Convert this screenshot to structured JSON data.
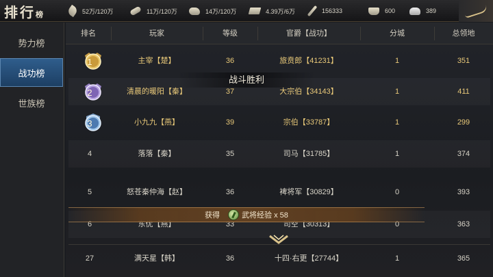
{
  "header": {
    "title": "排行",
    "subtitle": "榜",
    "resources": [
      {
        "icon": "wheat-icon",
        "value": "52万/120万"
      },
      {
        "icon": "wood-icon",
        "value": "11万/120万"
      },
      {
        "icon": "stone-icon",
        "value": "14万/120万"
      },
      {
        "icon": "iron-icon",
        "value": "4.39万/6万"
      },
      {
        "icon": "sword-icon",
        "value": "156333"
      },
      {
        "icon": "gold-ingot-icon",
        "value": "600"
      },
      {
        "icon": "silver-ingot-icon",
        "value": "389"
      }
    ]
  },
  "sidebar": {
    "items": [
      {
        "label": "势力榜"
      },
      {
        "label": "战功榜"
      },
      {
        "label": "世族榜"
      }
    ],
    "active_index": 1
  },
  "table": {
    "columns": [
      "排名",
      "玩家",
      "等级",
      "官爵【战功】",
      "分城",
      "总领地"
    ],
    "rows": [
      {
        "rank": "1",
        "player": "主宰【楚】",
        "level": "36",
        "title": "旅贲郎【41231】",
        "branch": "1",
        "territory": "351"
      },
      {
        "rank": "2",
        "player": "清晨的暖阳【秦】",
        "level": "37",
        "title": "大宗伯【34143】",
        "branch": "1",
        "territory": "411"
      },
      {
        "rank": "3",
        "player": "小九九【燕】",
        "level": "39",
        "title": "宗伯【33787】",
        "branch": "1",
        "territory": "299"
      },
      {
        "rank": "4",
        "player": "落落【秦】",
        "level": "35",
        "title": "司马【31785】",
        "branch": "1",
        "territory": "374"
      },
      {
        "rank": "5",
        "player": "怒苍秦仲海【赵】",
        "level": "36",
        "title": "裨将军【30829】",
        "branch": "0",
        "territory": "393"
      },
      {
        "rank": "6",
        "player": "东优【燕】",
        "level": "33",
        "title": "司空【30313】",
        "branch": "0",
        "territory": "363"
      },
      {
        "rank": "27",
        "player": "满天星【韩】",
        "level": "36",
        "title": "十四·右更【27744】",
        "branch": "1",
        "territory": "365"
      }
    ]
  },
  "overlays": {
    "victory_text": "战斗胜利",
    "gain_prefix": "获得",
    "gain_item": "武将经验 x 58"
  },
  "colors": {
    "active_tab": "#2f5d8c",
    "top_three_text": "#e9c979",
    "gain_banner": "#64422a"
  }
}
